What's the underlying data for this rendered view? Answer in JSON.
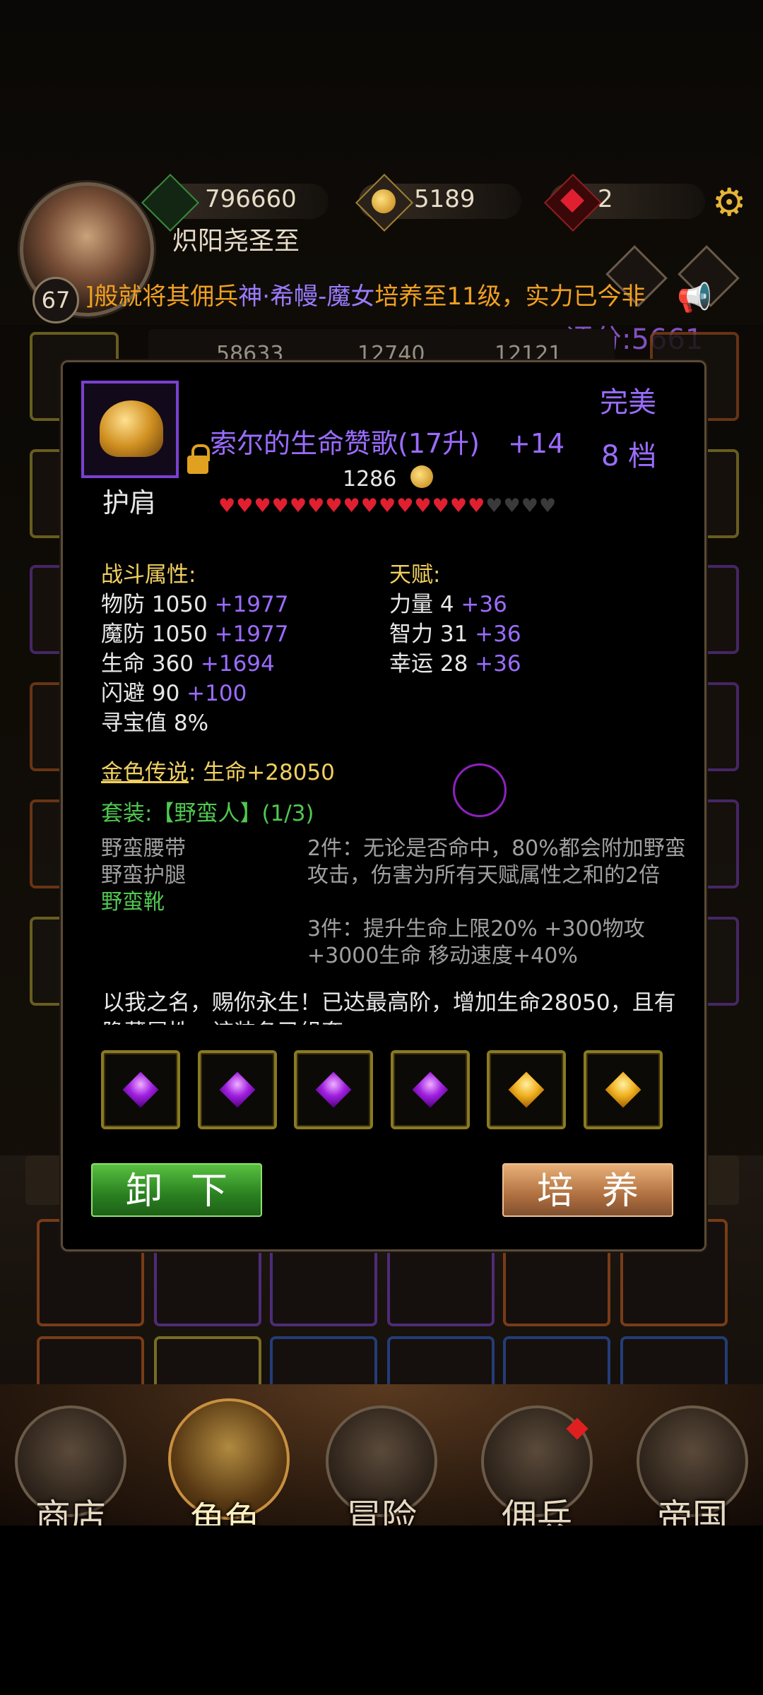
{
  "header": {
    "resource1_value": "796660",
    "resource2_value": "5189",
    "resource3_value": "2",
    "player_name": "炽阳尧圣至",
    "player_level": "67",
    "ticker_parts": [
      "]般就将其佣兵",
      "神·希幔-魔女",
      "培养至11级，实力已今非"
    ],
    "score": "评分:5661",
    "icons": [
      "sword-icon",
      "gold-coin-icon",
      "ruby-icon",
      "gear-icon",
      "megaphone-icon"
    ]
  },
  "stats_bar_partial": [
    "58633",
    "12740",
    "12121"
  ],
  "item": {
    "name": "索尔的生命赞歌(17升)",
    "plus": "+14",
    "quality": "完美",
    "tier": "8 档",
    "slot": "护肩",
    "price": "1286",
    "hearts_filled": 15,
    "hearts_empty": 4,
    "combat_title": "战斗属性:",
    "combat_stats": [
      {
        "label": "物防 1050",
        "bonus": "+1977"
      },
      {
        "label": "魔防 1050",
        "bonus": "+1977"
      },
      {
        "label": "生命 360",
        "bonus": "+1694"
      },
      {
        "label": "闪避 90",
        "bonus": "+100"
      },
      {
        "label": "寻宝值 8%",
        "bonus": ""
      }
    ],
    "talent_title": "天赋:",
    "talent_stats": [
      {
        "label": "力量 4",
        "bonus": "+36"
      },
      {
        "label": "智力 31",
        "bonus": "+36"
      },
      {
        "label": "幸运 28",
        "bonus": "+36"
      }
    ],
    "legend_label": "金色传说",
    "legend_value": ":  生命+28050",
    "set_title": "套装:【野蛮人】(1/3)",
    "set_items": [
      {
        "name": "野蛮腰带",
        "owned": false
      },
      {
        "name": "野蛮护腿",
        "owned": false
      },
      {
        "name": "野蛮靴",
        "owned": true
      }
    ],
    "set_bonus_2": "2件：无论是否命中，80%都会附加野蛮攻击，伤害为所有天赋属性之和的2倍",
    "set_bonus_3": "3件：提升生命上限20% +300物攻 +3000生命 移动速度+40%",
    "description": "以我之名，赐你永生！已达最高阶，增加生命28050，且有隐藏属性，该装备已组套",
    "gems": [
      "purple",
      "purple",
      "purple",
      "purple",
      "yellow",
      "yellow"
    ],
    "unequip_label": "卸下",
    "upgrade_label": "培养"
  },
  "nav": {
    "items": [
      {
        "label": "商店",
        "icon": "shop-icon"
      },
      {
        "label": "角色",
        "icon": "hood-icon"
      },
      {
        "label": "冒险",
        "icon": "crossed-swords-icon"
      },
      {
        "label": "佣兵",
        "icon": "mercenary-icon"
      },
      {
        "label": "帝国",
        "icon": "crown-icon"
      }
    ]
  },
  "colors": {
    "gold": "#f0d060",
    "purple": "#9b6cff",
    "green": "#50c850",
    "accent": "#e6b43a"
  }
}
